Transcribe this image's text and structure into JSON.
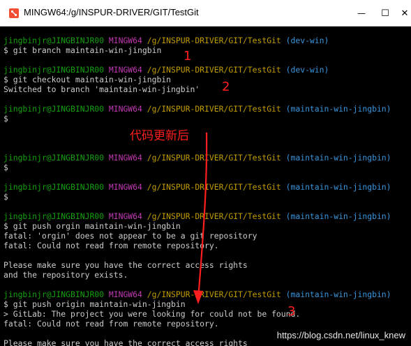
{
  "window": {
    "title": "MINGW64:/g/INSPUR-DRIVER/GIT/TestGit",
    "minimize_glyph": "—",
    "maximize_glyph": "☐",
    "close_glyph": "✕"
  },
  "prompt": {
    "user_host": "jingbinjr@JINGBINJR00",
    "env": "MINGW64",
    "path": "/g/INSPUR-DRIVER/GIT/TestGit"
  },
  "terminal": {
    "blocks": [
      {
        "branch": "(dev-win)",
        "cmd": "$ git branch maintain-win-jingbin"
      },
      {
        "branch": "(dev-win)",
        "cmd": "$ git checkout maintain-win-jingbin",
        "out": "Switched to branch 'maintain-win-jingbin'"
      },
      {
        "branch": "(maintain-win-jingbin)",
        "cmd": "$"
      },
      {
        "branch": "(maintain-win-jingbin)",
        "cmd": "$"
      },
      {
        "branch": "(maintain-win-jingbin)",
        "cmd": "$"
      },
      {
        "branch": "(maintain-win-jingbin)",
        "cmd": "$ git push orgin maintain-win-jingbin",
        "out1": "fatal: 'orgin' does not appear to be a git repository",
        "out2": "fatal: Could not read from remote repository.",
        "out3": "Please make sure you have the correct access rights",
        "out4": "and the repository exists."
      },
      {
        "branch": "(maintain-win-jingbin)",
        "cmd": "$ git push origin maintain-win-jingbin",
        "out1": "> GitLab: The project you were looking for could not be found.",
        "out2": "fatal: Could not read from remote repository.",
        "out3": "Please make sure you have the correct access rights"
      }
    ]
  },
  "annotations": {
    "num1": "1",
    "num2": "2",
    "num3": "3",
    "note": "代码更新后",
    "color": "#ff1e1e"
  },
  "watermark": "https://blog.csdn.net/linux_knew"
}
